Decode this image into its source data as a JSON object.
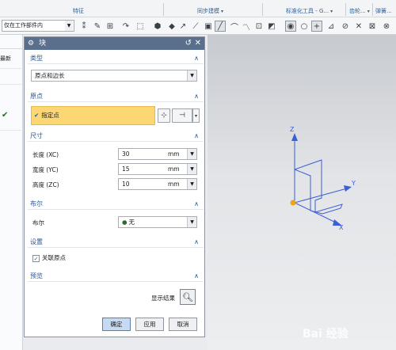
{
  "ribbon": {
    "groups": [
      "特征",
      "同步建模",
      "标准化工具 - G...",
      "齿轮...",
      "弹簧..."
    ]
  },
  "toolbar": {
    "scope_value": "仅在工作部件内"
  },
  "left_panel": {
    "latest_label": "最新"
  },
  "dialog": {
    "title": "块",
    "type": {
      "header": "类型",
      "selected": "原点和边长"
    },
    "origin": {
      "header": "原点",
      "specify_point": "指定点"
    },
    "dimensions": {
      "header": "尺寸",
      "rows": [
        {
          "label": "长度 (XC)",
          "value": "30",
          "unit": "mm"
        },
        {
          "label": "宽度 (YC)",
          "value": "15",
          "unit": "mm"
        },
        {
          "label": "高度 (ZC)",
          "value": "10",
          "unit": "mm"
        }
      ]
    },
    "boolean": {
      "header": "布尔",
      "label": "布尔",
      "value": "无"
    },
    "settings": {
      "header": "设置",
      "associative_origin": "关联原点",
      "associative_checked": true
    },
    "preview": {
      "header": "预览",
      "show_result": "显示结果"
    },
    "buttons": {
      "ok": "确定",
      "apply": "应用",
      "cancel": "取消"
    }
  },
  "viewport": {
    "axes": [
      "Z",
      "Y",
      "X"
    ]
  },
  "watermark": {
    "text": "Bai 经验"
  }
}
